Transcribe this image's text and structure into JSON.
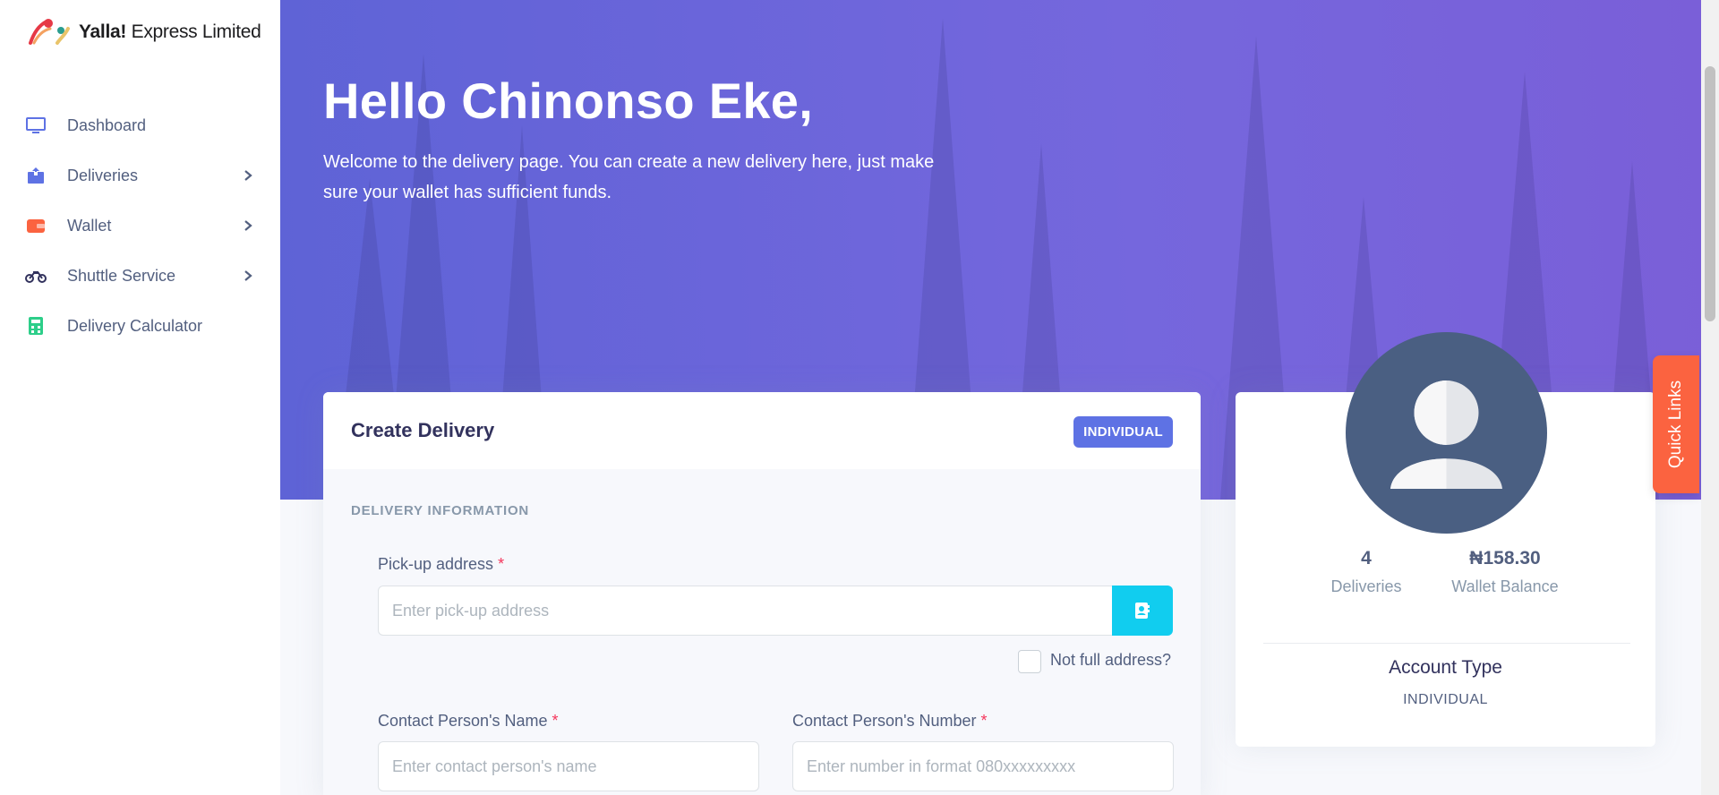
{
  "brand": {
    "name_bold": "Yalla!",
    "name_rest": " Express Limited"
  },
  "sidebar": {
    "items": [
      {
        "label": "Dashboard",
        "icon": "monitor-icon",
        "has_submenu": false
      },
      {
        "label": "Deliveries",
        "icon": "box-icon",
        "has_submenu": true
      },
      {
        "label": "Wallet",
        "icon": "wallet-icon",
        "has_submenu": true
      },
      {
        "label": "Shuttle Service",
        "icon": "motorcycle-icon",
        "has_submenu": true
      },
      {
        "label": "Delivery Calculator",
        "icon": "calculator-icon",
        "has_submenu": false
      }
    ]
  },
  "header": {
    "greeting": "Hello Chinonso Eke,",
    "subtitle": "Welcome to the delivery page. You can create a new delivery here, just make sure your wallet has sufficient funds."
  },
  "create_delivery": {
    "title": "Create Delivery",
    "badge": "INDIVIDUAL",
    "section_title": "DELIVERY INFORMATION",
    "pickup": {
      "label": "Pick-up address",
      "required_mark": "*",
      "placeholder": "Enter pick-up address"
    },
    "not_full_address": "Not full address?",
    "contact_name": {
      "label": "Contact Person's Name",
      "required_mark": "*",
      "placeholder": "Enter contact person's name"
    },
    "contact_number": {
      "label": "Contact Person's Number",
      "required_mark": "*",
      "placeholder": "Enter number in format 080xxxxxxxxx"
    }
  },
  "profile": {
    "deliveries_count": "4",
    "deliveries_label": "Deliveries",
    "wallet_balance": "₦158.30",
    "wallet_label": "Wallet Balance",
    "account_type_title": "Account Type",
    "account_type_value": "INDIVIDUAL"
  },
  "quick_links": {
    "label": "Quick Links"
  },
  "colors": {
    "primary": "#5e72e4",
    "info": "#11cdef",
    "warning": "#fb6340",
    "danger": "#f5365c",
    "avatar": "#4a5f82"
  }
}
